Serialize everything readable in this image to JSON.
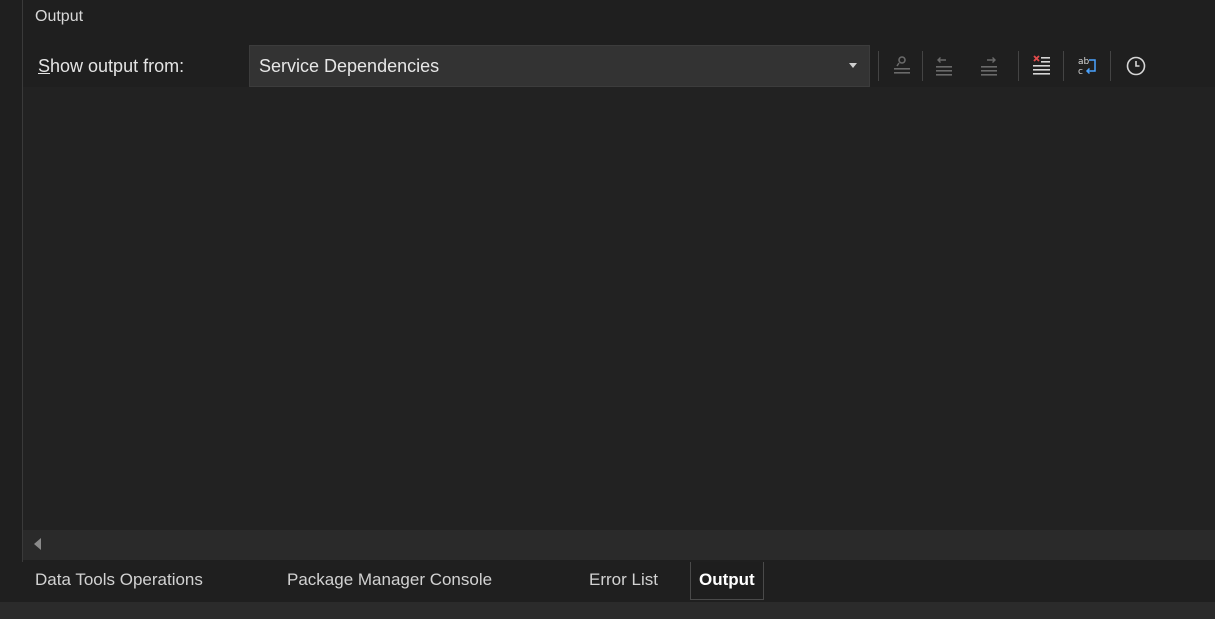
{
  "panel": {
    "title": "Output"
  },
  "toolbar": {
    "show_output_label_prefix": "S",
    "show_output_label_rest": "how output from:",
    "source_selected": "Service Dependencies",
    "buttons": [
      {
        "name": "find-message-in-code-icon",
        "enabled": false
      },
      {
        "name": "go-to-previous-message-icon",
        "enabled": false
      },
      {
        "name": "go-to-next-message-icon",
        "enabled": false
      },
      {
        "name": "clear-all-icon",
        "enabled": true
      },
      {
        "name": "toggle-word-wrap-icon",
        "enabled": true
      },
      {
        "name": "toggle-timestamps-icon",
        "enabled": true
      }
    ]
  },
  "colors": {
    "background": "#1f1f1f",
    "content_background": "#222222",
    "accent_red": "#e04b4b",
    "accent_blue": "#4aa3ff",
    "disabled_icon": "#6a6a6a"
  },
  "tabs": [
    {
      "label": "Data Tools Operations",
      "active": false
    },
    {
      "label": "Package Manager Console",
      "active": false
    },
    {
      "label": "Error List",
      "active": false
    },
    {
      "label": "Output",
      "active": true
    }
  ]
}
